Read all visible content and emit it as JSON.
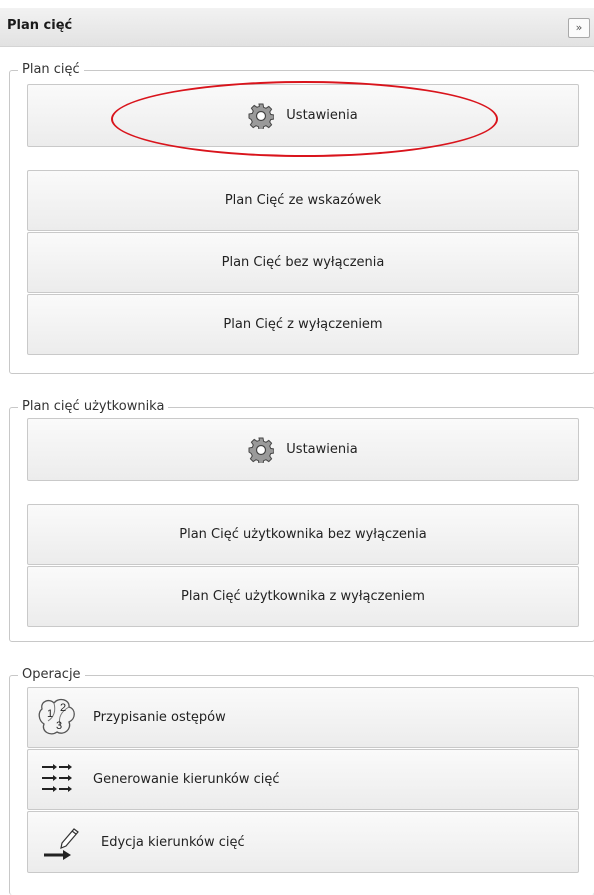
{
  "panel": {
    "title": "Plan cięć",
    "collapse_glyph": "»",
    "collapse_icon": "double-chevron-right-icon"
  },
  "groups": [
    {
      "legend": "Plan cięć",
      "settings_label": "Ustawienia",
      "settings_icon": "gear-icon",
      "buttons": [
        "Plan Cięć ze wskazówek",
        "Plan Cięć bez wyłączenia",
        "Plan Cięć z wyłączeniem"
      ]
    },
    {
      "legend": "Plan cięć użytkownika",
      "settings_label": "Ustawienia",
      "settings_icon": "gear-icon",
      "buttons": [
        "Plan Cięć użytkownika bez wyłączenia",
        "Plan Cięć użytkownika z wyłączeniem"
      ]
    },
    {
      "legend": "Operacje",
      "buttons": [
        {
          "label": "Przypisanie ostępów",
          "icon": "numbered-regions-icon"
        },
        {
          "label": "Generowanie kierunków cięć",
          "icon": "arrows-grid-icon"
        },
        {
          "label": "Edycja kierunków cięć",
          "icon": "pencil-arrow-icon"
        }
      ]
    }
  ],
  "annotation": {
    "color": "#d9141c"
  }
}
